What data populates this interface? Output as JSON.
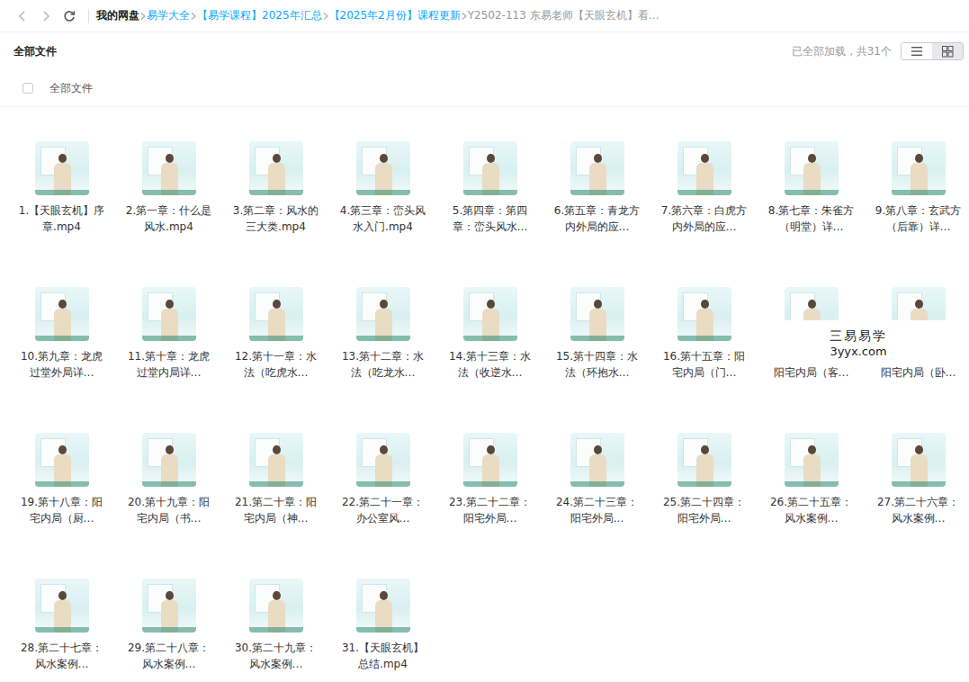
{
  "breadcrumb": [
    {
      "label": "我的网盘",
      "current": false
    },
    {
      "label": "易学大全",
      "current": false
    },
    {
      "label": "【易学课程】2025年汇总",
      "current": false
    },
    {
      "label": "【2025年2月份】课程更新",
      "current": false
    },
    {
      "label": "Y2502-113 东易老师【天眼玄机】看…",
      "current": true
    }
  ],
  "header": {
    "title": "全部文件",
    "count": "已全部加载，共31个"
  },
  "view_toggle": [
    {
      "kind": "list",
      "selected": false
    },
    {
      "kind": "grid",
      "selected": true
    }
  ],
  "select_all": {
    "label": "全部文件",
    "checked": false
  },
  "files": [
    {
      "label": "1.【天眼玄机】序章.mp4",
      "kind": "video"
    },
    {
      "label": "2.第一章：什么是风水.mp4",
      "kind": "video"
    },
    {
      "label": "3.第二章：风水的三大类.mp4",
      "kind": "video"
    },
    {
      "label": "4.第三章：峦头风水入门.mp4",
      "kind": "video"
    },
    {
      "label": "5.第四章：第四章：峦头风水…",
      "kind": "video"
    },
    {
      "label": "6.第五章：青龙方内外局的应…",
      "kind": "video"
    },
    {
      "label": "7.第六章：白虎方内外局的应…",
      "kind": "video"
    },
    {
      "label": "8.第七章：朱雀方（明堂）详…",
      "kind": "video"
    },
    {
      "label": "9.第八章：玄武方（后靠）详…",
      "kind": "video"
    },
    {
      "label": "10.第九章：龙虎过堂外局详…",
      "kind": "video"
    },
    {
      "label": "11.第十章：龙虎过堂内局详…",
      "kind": "video"
    },
    {
      "label": "12.第十一章：水法（吃虎水…",
      "kind": "video"
    },
    {
      "label": "13.第十二章：水法（吃龙水…",
      "kind": "video"
    },
    {
      "label": "14.第十三章：水法（收逆水…",
      "kind": "video"
    },
    {
      "label": "15.第十四章：水法（环抱水…",
      "kind": "video"
    },
    {
      "label": "16.第十五章：阳宅内局（门…",
      "kind": "video"
    },
    {
      "label": "阳宅内局（客…",
      "kind": "covered"
    },
    {
      "label": "阳宅内局（卧…",
      "kind": "covered"
    },
    {
      "label": "19.第十八章：阳宅内局（厨…",
      "kind": "video"
    },
    {
      "label": "20.第十九章：阳宅内局（书…",
      "kind": "video"
    },
    {
      "label": "21.第二十章：阳宅内局（神…",
      "kind": "video"
    },
    {
      "label": "22.第二十一章：办公室风…",
      "kind": "video"
    },
    {
      "label": "23.第二十二章：阳宅外局…",
      "kind": "video"
    },
    {
      "label": "24.第二十三章：阳宅外局…",
      "kind": "video"
    },
    {
      "label": "25.第二十四章：阳宅外局…",
      "kind": "video"
    },
    {
      "label": "26.第二十五章：风水案例…",
      "kind": "video"
    },
    {
      "label": "27.第二十六章：风水案例…",
      "kind": "video"
    },
    {
      "label": "28.第二十七章：风水案例…",
      "kind": "video"
    },
    {
      "label": "29.第二十八章：风水案例…",
      "kind": "video"
    },
    {
      "label": "30.第二十九章：风水案例…",
      "kind": "video"
    },
    {
      "label": "31.【天眼玄机】总结.mp4",
      "kind": "video"
    }
  ],
  "watermark": {
    "title": "三易易学",
    "url": "3yyx.com"
  }
}
